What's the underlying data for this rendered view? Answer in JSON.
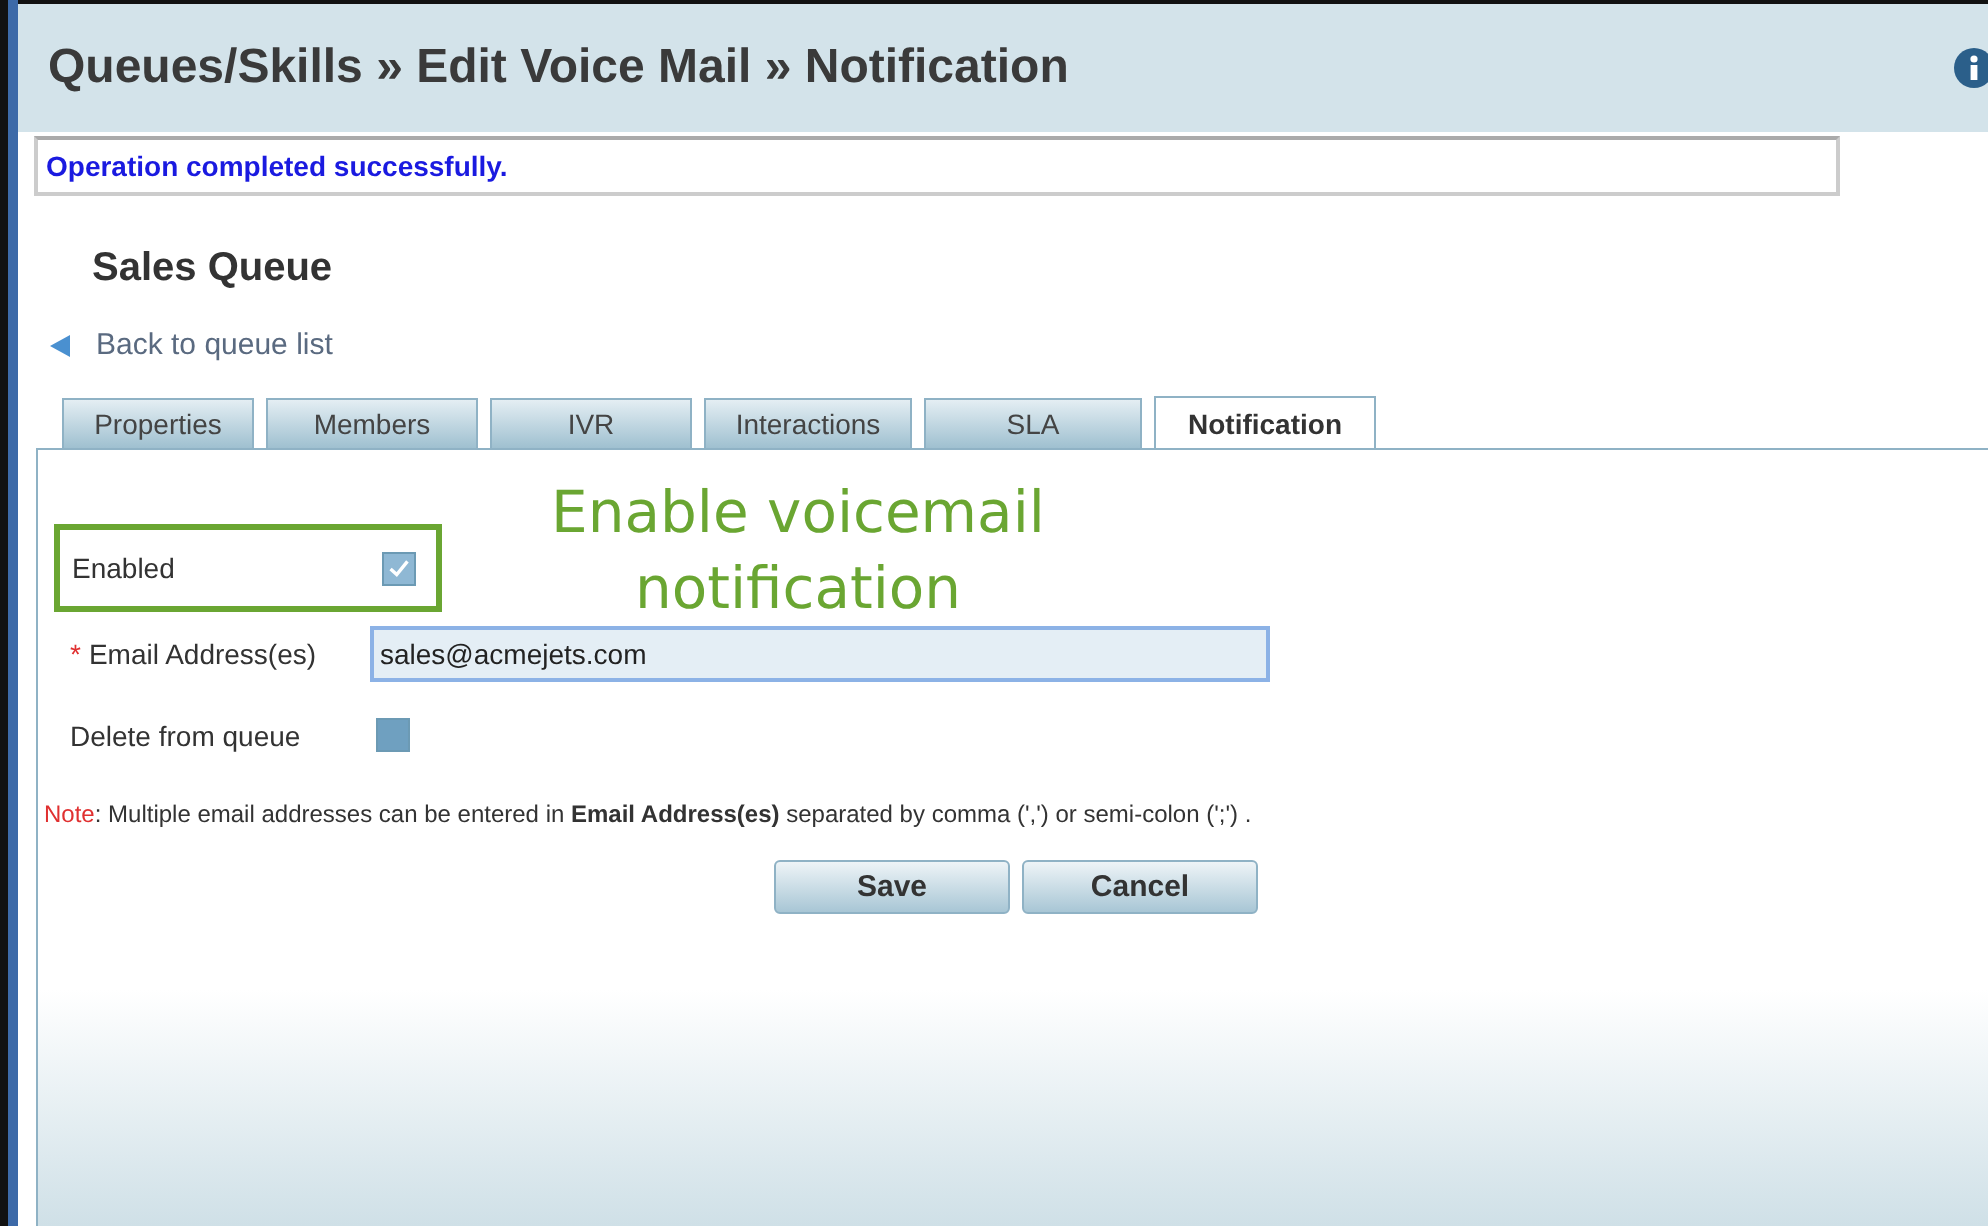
{
  "header": {
    "title": "Queues/Skills » Edit Voice Mail » Notification"
  },
  "message": "Operation completed successfully.",
  "queue_name": "Sales Queue",
  "back_link": "Back to queue list",
  "tabs": [
    {
      "label": "Properties",
      "selected": false
    },
    {
      "label": "Members",
      "selected": false
    },
    {
      "label": "IVR",
      "selected": false
    },
    {
      "label": "Interactions",
      "selected": false
    },
    {
      "label": "SLA",
      "selected": false
    },
    {
      "label": "Notification",
      "selected": true
    }
  ],
  "annotation": "Enable voicemail notification",
  "fields": [
    {
      "kind": "checkbox",
      "label": "Enabled",
      "checked": true,
      "highlighted": true
    },
    {
      "kind": "text",
      "label": "Email Address(es)",
      "required": true,
      "required_mark": "*",
      "value": "sales@acmejets.com"
    },
    {
      "kind": "checkbox",
      "label": "Delete from queue",
      "checked": false,
      "highlighted": false
    }
  ],
  "note": {
    "label": "Note",
    "text": ": Multiple email addresses can be entered in **Email Address(es)** separated by comma (',') or semi-colon (';') ."
  },
  "buttons": [
    "Save",
    "Cancel"
  ]
}
